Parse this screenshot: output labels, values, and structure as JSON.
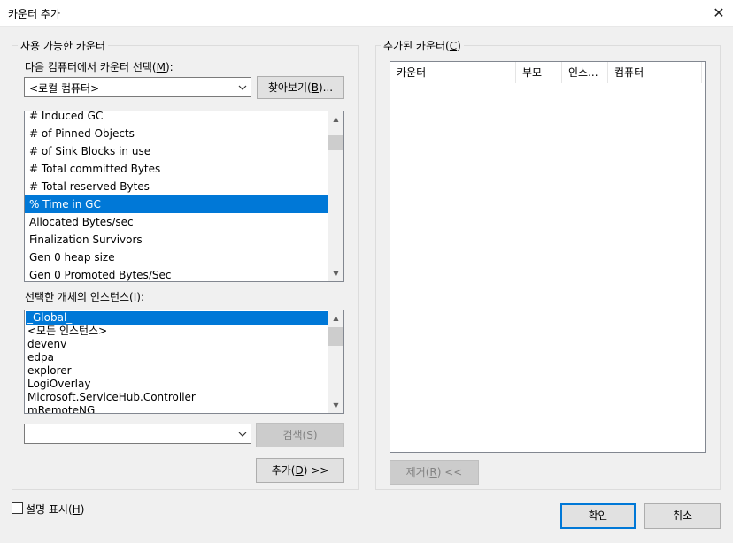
{
  "window": {
    "title": "카운터 추가",
    "close_glyph": "✕"
  },
  "available": {
    "legend": "사용 가능한 카운터",
    "computer_label": "다음 컴퓨터에서 카운터 선택(M):",
    "computer_value": "<로컬 컴퓨터>",
    "browse_label": "찾아보기(B)...",
    "counters": [
      "# Induced GC",
      "# of Pinned Objects",
      "# of Sink Blocks in use",
      "# Total committed Bytes",
      "# Total reserved Bytes",
      "% Time in GC",
      "Allocated Bytes/sec",
      "Finalization Survivors",
      "Gen 0 heap size",
      "Gen 0 Promoted Bytes/Sec"
    ],
    "selected_counter": "% Time in GC",
    "instances_label": "선택한 개체의 인스턴스(I):",
    "instances": [
      "_Global_",
      "<모든 인스턴스>",
      "devenv",
      "edpa",
      "explorer",
      "LogiOverlay",
      "Microsoft.ServiceHub.Controller",
      "mRemoteNG"
    ],
    "selected_instance": "_Global_",
    "search_value": "",
    "search_label": "검색(S)",
    "add_label": "추가(D) >>"
  },
  "added": {
    "legend": "추가된 카운터(C)",
    "columns": [
      "카운터",
      "부모",
      "인스...",
      "컴퓨터"
    ],
    "remove_label": "제거(R) <<"
  },
  "footer": {
    "show_description_label": "설명 표시(H)",
    "show_description_checked": false,
    "ok_label": "확인",
    "cancel_label": "취소"
  },
  "colors": {
    "selection": "#0078d7",
    "dialog_bg": "#f0f0f0"
  },
  "icons": {
    "dropdown": "chevron-down-icon",
    "scroll_up": "scroll-up-icon",
    "scroll_down": "scroll-down-icon"
  }
}
